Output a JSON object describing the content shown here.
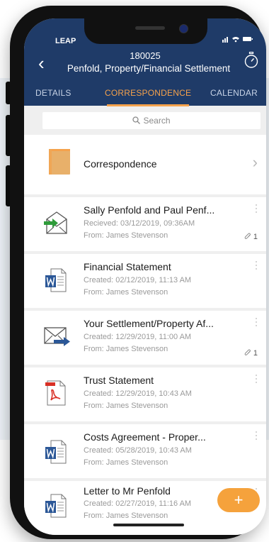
{
  "status_bar": {
    "carrier": "LEAP"
  },
  "header": {
    "matter_number": "180025",
    "matter_title": "Penfold, Property/Financial Settlement"
  },
  "tabs": [
    {
      "label": "DETAILS"
    },
    {
      "label": "CORRESPONDENCE"
    },
    {
      "label": "CALENDAR"
    }
  ],
  "search": {
    "placeholder": "Search"
  },
  "folder": {
    "label": "Correspondence"
  },
  "items": [
    {
      "icon": "email-incoming-icon",
      "title": "Sally Penfold and Paul Penf...",
      "date": "Recieved: 03/12/2019,  09:36AM",
      "from": "From: James Stevenson",
      "attachments": "1"
    },
    {
      "icon": "word-document-icon",
      "title": "Financial Statement",
      "date": "Created: 02/12/2019,  11:13 AM",
      "from": "From: James Stevenson",
      "attachments": ""
    },
    {
      "icon": "email-outgoing-icon",
      "title": "Your Settlement/Property Af...",
      "date": "Created: 12/29/2019,  11:00 AM",
      "from": "From: James Stevenson",
      "attachments": "1"
    },
    {
      "icon": "pdf-document-icon",
      "title": "Trust Statement",
      "date": "Created: 12/29/2019,  10:43 AM",
      "from": "From: James Stevenson",
      "attachments": ""
    },
    {
      "icon": "word-document-icon",
      "title": "Costs Agreement - Proper...",
      "date": "Created: 05/28/2019,  10:43 AM",
      "from": "From: James Stevenson",
      "attachments": ""
    },
    {
      "icon": "word-document-icon",
      "title": "Letter to Mr Penfold",
      "date": "Created: 02/27/2019,  11:16 AM",
      "from": "From: James Stevenson",
      "attachments": ""
    }
  ],
  "fab": {
    "label": "+"
  },
  "colors": {
    "header": "#1f3b68",
    "accent": "#f5a24c",
    "word_blue": "#2b5797",
    "pdf_red": "#d93025",
    "email_green": "#2e9b3a"
  }
}
